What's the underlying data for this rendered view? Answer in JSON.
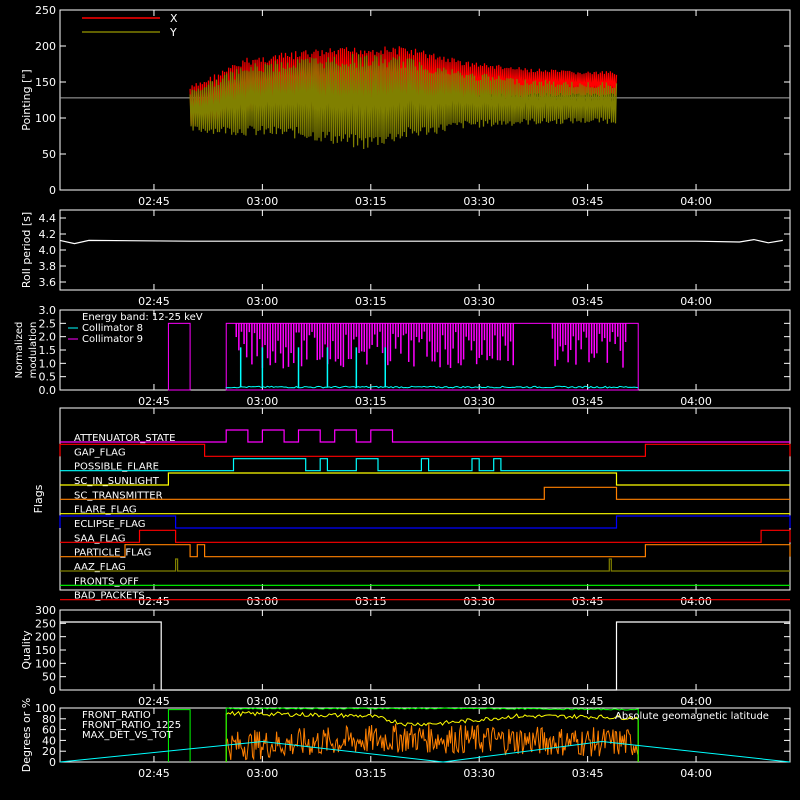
{
  "x_ticks": [
    "02:45",
    "03:00",
    "03:15",
    "03:30",
    "03:45",
    "04:00"
  ],
  "chart_data": [
    {
      "type": "line",
      "name": "pointing",
      "ylabel": "Pointing [\"]",
      "ylim": [
        0,
        250
      ],
      "yticks": [
        "0",
        "50",
        "100",
        "150",
        "200",
        "250"
      ],
      "legend": [
        {
          "label": "X",
          "color": "#ff0000"
        },
        {
          "label": "Y",
          "color": "#808000"
        }
      ],
      "reference_line": 128,
      "series": [
        {
          "name": "X",
          "color": "#ff0000",
          "x": [
            "02:50",
            "02:58",
            "03:06",
            "03:14",
            "03:20",
            "03:28",
            "03:36",
            "03:44",
            "03:49"
          ],
          "y_high": [
            145,
            185,
            195,
            200,
            200,
            180,
            170,
            165,
            165
          ],
          "y_low": [
            85,
            105,
            110,
            115,
            120,
            125,
            128,
            130,
            130
          ]
        },
        {
          "name": "Y",
          "color": "#808000",
          "x": [
            "02:50",
            "02:58",
            "03:06",
            "03:14",
            "03:20",
            "03:28",
            "03:36",
            "03:44",
            "03:49"
          ],
          "y_high": [
            140,
            175,
            185,
            190,
            185,
            165,
            155,
            150,
            150
          ],
          "y_low": [
            80,
            75,
            70,
            55,
            70,
            85,
            90,
            92,
            92
          ]
        }
      ]
    },
    {
      "type": "line",
      "name": "roll-period",
      "ylabel": "Roll period [s]",
      "ylim": [
        3.5,
        4.5
      ],
      "yticks": [
        "3.6",
        "3.8",
        "4.0",
        "4.2",
        "4.4"
      ],
      "series": [
        {
          "name": "roll",
          "color": "#ffffff",
          "x": [
            "02:32",
            "02:34",
            "02:36",
            "02:50",
            "03:35",
            "03:55",
            "04:00",
            "04:06",
            "04:08",
            "04:10",
            "04:12"
          ],
          "y": [
            4.12,
            4.08,
            4.12,
            4.11,
            4.11,
            4.11,
            4.11,
            4.1,
            4.13,
            4.09,
            4.12
          ]
        }
      ]
    },
    {
      "type": "line",
      "name": "modulation",
      "ylabel": "Normalized modulation",
      "ylim": [
        0,
        3.0
      ],
      "yticks": [
        "0.0",
        "0.5",
        "1.0",
        "1.5",
        "2.0",
        "2.5",
        "3.0"
      ],
      "legend": [
        {
          "label": "Energy band: 12-25 keV",
          "color": "#ffffff"
        },
        {
          "label": "Collimator 8",
          "color": "#00ffff"
        },
        {
          "label": "Collimator 9",
          "color": "#ff00ff"
        }
      ],
      "series": [
        {
          "name": "Collimator 9",
          "color": "#ff00ff",
          "x_range": [
            "02:55",
            "03:52"
          ],
          "level": 2.5
        },
        {
          "name": "Collimator 8",
          "color": "#00ffff",
          "x_range": [
            "02:55",
            "03:52"
          ],
          "level": 0.1
        }
      ]
    },
    {
      "type": "table",
      "name": "flags",
      "ylabel": "Flags",
      "rows": [
        {
          "label": "ATTENUATOR_STATE",
          "color": "#ff00ff",
          "on": [
            [
              "02:55",
              "02:58"
            ],
            [
              "03:00",
              "03:03"
            ],
            [
              "03:05",
              "03:08"
            ],
            [
              "03:10",
              "03:13"
            ],
            [
              "03:15",
              "03:18"
            ]
          ]
        },
        {
          "label": "GAP_FLAG",
          "color": "#ff0000",
          "on": [
            [
              "02:32",
              "02:52"
            ],
            [
              "03:53",
              "04:13"
            ]
          ]
        },
        {
          "label": "POSSIBLE_FLARE",
          "color": "#00ffff",
          "on": [
            [
              "02:56",
              "03:06"
            ],
            [
              "03:08",
              "03:09"
            ],
            [
              "03:13",
              "03:16"
            ],
            [
              "03:22",
              "03:23"
            ],
            [
              "03:29",
              "03:30"
            ],
            [
              "03:32",
              "03:33"
            ]
          ]
        },
        {
          "label": "SC_IN_SUNLIGHT",
          "color": "#ffff00",
          "on": [
            [
              "02:47",
              "03:49"
            ]
          ]
        },
        {
          "label": "SC_TRANSMITTER",
          "color": "#ff8000",
          "on": [
            [
              "03:39",
              "03:49"
            ]
          ]
        },
        {
          "label": "FLARE_FLAG",
          "color": "#ffff00",
          "on": []
        },
        {
          "label": "ECLIPSE_FLAG",
          "color": "#0000ff",
          "on": [
            [
              "02:32",
              "02:48"
            ],
            [
              "03:49",
              "04:13"
            ]
          ]
        },
        {
          "label": "SAA_FLAG",
          "color": "#ff0000",
          "on": [
            [
              "02:43",
              "02:48"
            ],
            [
              "04:09",
              "04:13"
            ]
          ]
        },
        {
          "label": "PARTICLE_FLAG",
          "color": "#ff8000",
          "on": [
            [
              "02:41",
              "02:50"
            ],
            [
              "02:51",
              "02:52"
            ],
            [
              "03:53",
              "04:13"
            ]
          ]
        },
        {
          "label": "AAZ_FLAG",
          "color": "#808000",
          "on": [
            [
              "02:48",
              "02:48"
            ],
            [
              "03:48",
              "03:48"
            ]
          ]
        },
        {
          "label": "FRONTS_OFF",
          "color": "#00ff00",
          "on": []
        },
        {
          "label": "BAD_PACKETS",
          "color": "#ff0000",
          "on": []
        }
      ]
    },
    {
      "type": "line",
      "name": "quality",
      "ylabel": "Quality",
      "ylim": [
        0,
        300
      ],
      "yticks": [
        "0",
        "50",
        "100",
        "150",
        "200",
        "250",
        "300"
      ],
      "series": [
        {
          "name": "quality",
          "color": "#ffffff",
          "x": [
            "02:32",
            "02:46",
            "02:46",
            "03:49",
            "03:49",
            "04:13"
          ],
          "y": [
            255,
            255,
            0,
            0,
            255,
            255
          ]
        }
      ]
    },
    {
      "type": "line",
      "name": "fronts",
      "ylabel": "Degrees or %",
      "ylim": [
        0,
        100
      ],
      "yticks": [
        "0",
        "20",
        "40",
        "60",
        "80",
        "100"
      ],
      "legend": [
        {
          "label": "FRONT_RATIO",
          "color": "#ffff00"
        },
        {
          "label": "FRONT_RATIO_1225",
          "color": "#00ff00"
        },
        {
          "label": "MAX_DET_VS_TOT",
          "color": "#ff8000"
        },
        {
          "label": "Absolute geomagnetic latitude",
          "color": "#00ffff"
        }
      ],
      "series": [
        {
          "name": "FRONT_RATIO",
          "color": "#ffff00",
          "x": [
            "02:55",
            "03:05",
            "03:15",
            "03:20",
            "03:25",
            "03:35",
            "03:45",
            "03:52"
          ],
          "y": [
            90,
            88,
            85,
            70,
            72,
            85,
            84,
            82
          ]
        },
        {
          "name": "FRONT_RATIO_1225",
          "color": "#00ff00",
          "x": [
            "02:55",
            "03:30",
            "03:52"
          ],
          "y": [
            99,
            99,
            97
          ]
        },
        {
          "name": "MAX_DET_VS_TOT",
          "color": "#ff8000",
          "x": [
            "02:55",
            "03:10",
            "03:20",
            "03:35",
            "03:52"
          ],
          "y": [
            30,
            38,
            45,
            40,
            35
          ]
        },
        {
          "name": "Absolute geomagnetic latitude",
          "color": "#00ffff",
          "x": [
            "02:32",
            "03:00",
            "03:25",
            "03:47",
            "04:13"
          ],
          "y": [
            0,
            38,
            0,
            38,
            0
          ]
        }
      ]
    }
  ]
}
